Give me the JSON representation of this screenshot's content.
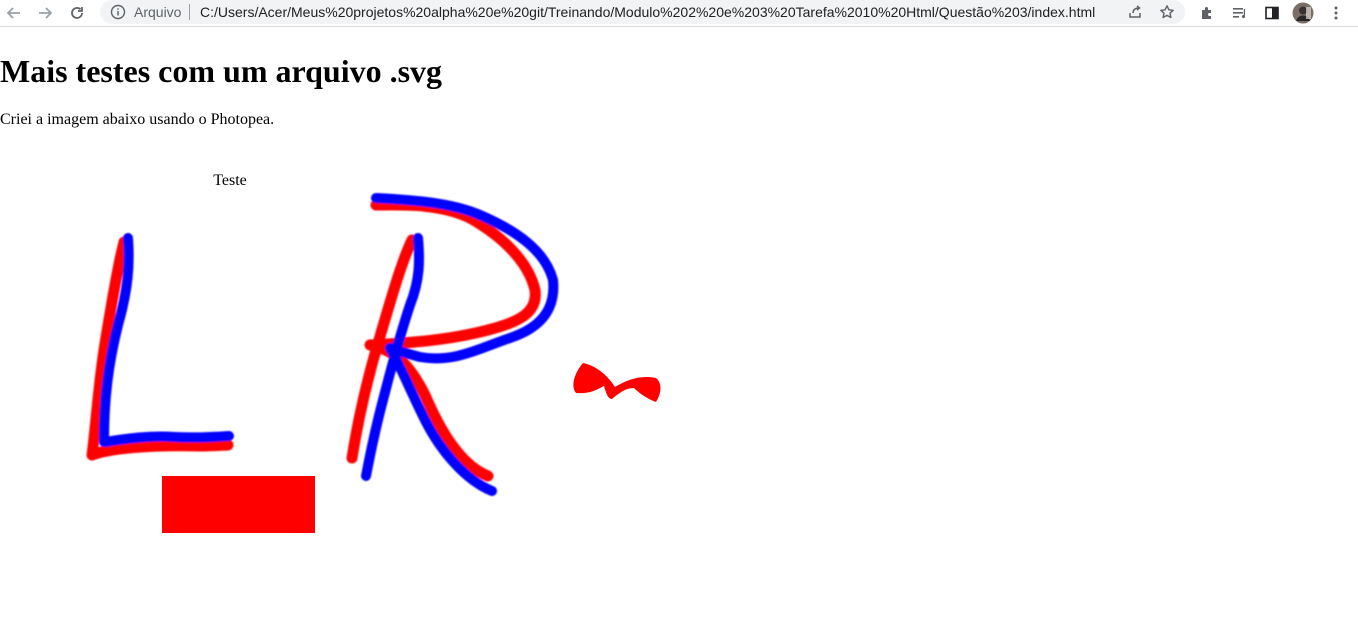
{
  "browser": {
    "scheme_label": "Arquivo",
    "url": "C:/Users/Acer/Meus%20projetos%20alpha%20e%20git/Treinando/Modulo%202%20e%203%20Tarefa%2010%20Html/Questão%203/index.html",
    "icons": [
      "back-arrow-icon",
      "forward-arrow-icon",
      "reload-icon",
      "info-icon",
      "share-icon",
      "star-icon",
      "puzzle-icon",
      "media-control-icon",
      "side-panel-icon",
      "avatar",
      "kebab-menu-icon"
    ]
  },
  "page": {
    "title": "Mais testes com um arquivo .svg",
    "intro": "Criei a imagem abaixo usando o Photopea.",
    "svg_text": "Teste"
  },
  "colors": {
    "red": "#ff0000",
    "blue": "#0000ff"
  }
}
